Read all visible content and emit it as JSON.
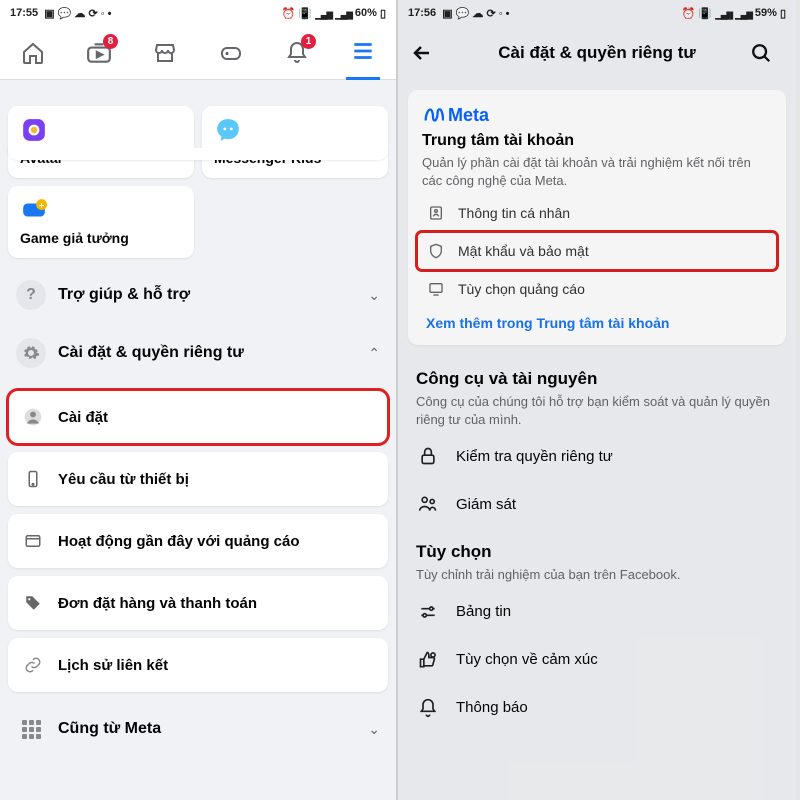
{
  "left": {
    "status": {
      "time": "17:55",
      "battery": "60%"
    },
    "nav": {
      "badge_video": "8",
      "badge_bell": "1"
    },
    "tiles": {
      "avatar": "Avatar",
      "messenger_kids": "Messenger Kids",
      "fantasy_game": "Game giả tưởng"
    },
    "sections": {
      "help": "Trợ giúp & hỗ trợ",
      "settings_privacy": "Cài đặt & quyền riêng tư",
      "also_meta": "Cũng từ Meta"
    },
    "subitems": {
      "settings": "Cài đặt",
      "device_requests": "Yêu cầu từ thiết bị",
      "recent_ad_activity": "Hoạt động gần đây với quảng cáo",
      "orders_payments": "Đơn đặt hàng và thanh toán",
      "link_history": "Lịch sử liên kết"
    }
  },
  "right": {
    "status": {
      "time": "17:56",
      "battery": "59%"
    },
    "header": {
      "title": "Cài đặt & quyền riêng tư"
    },
    "meta_card": {
      "brand": "Meta",
      "title": "Trung tâm tài khoản",
      "desc": "Quản lý phần cài đặt tài khoản và trải nghiệm kết nối trên các công nghệ của Meta.",
      "personal_info": "Thông tin cá nhân",
      "password_security": "Mật khẩu và bảo mật",
      "ad_prefs": "Tùy chọn quảng cáo",
      "see_more": "Xem thêm trong Trung tâm tài khoản"
    },
    "tools": {
      "title": "Công cụ và tài nguyên",
      "desc": "Công cụ của chúng tôi hỗ trợ bạn kiểm soát và quản lý quyền riêng tư của mình.",
      "privacy_checkup": "Kiểm tra quyền riêng tư",
      "supervision": "Giám sát"
    },
    "prefs": {
      "title": "Tùy chọn",
      "desc": "Tùy chỉnh trải nghiệm của bạn trên Facebook.",
      "news_feed": "Bảng tin",
      "reaction_prefs": "Tùy chọn về cảm xúc",
      "notifications": "Thông báo"
    }
  }
}
